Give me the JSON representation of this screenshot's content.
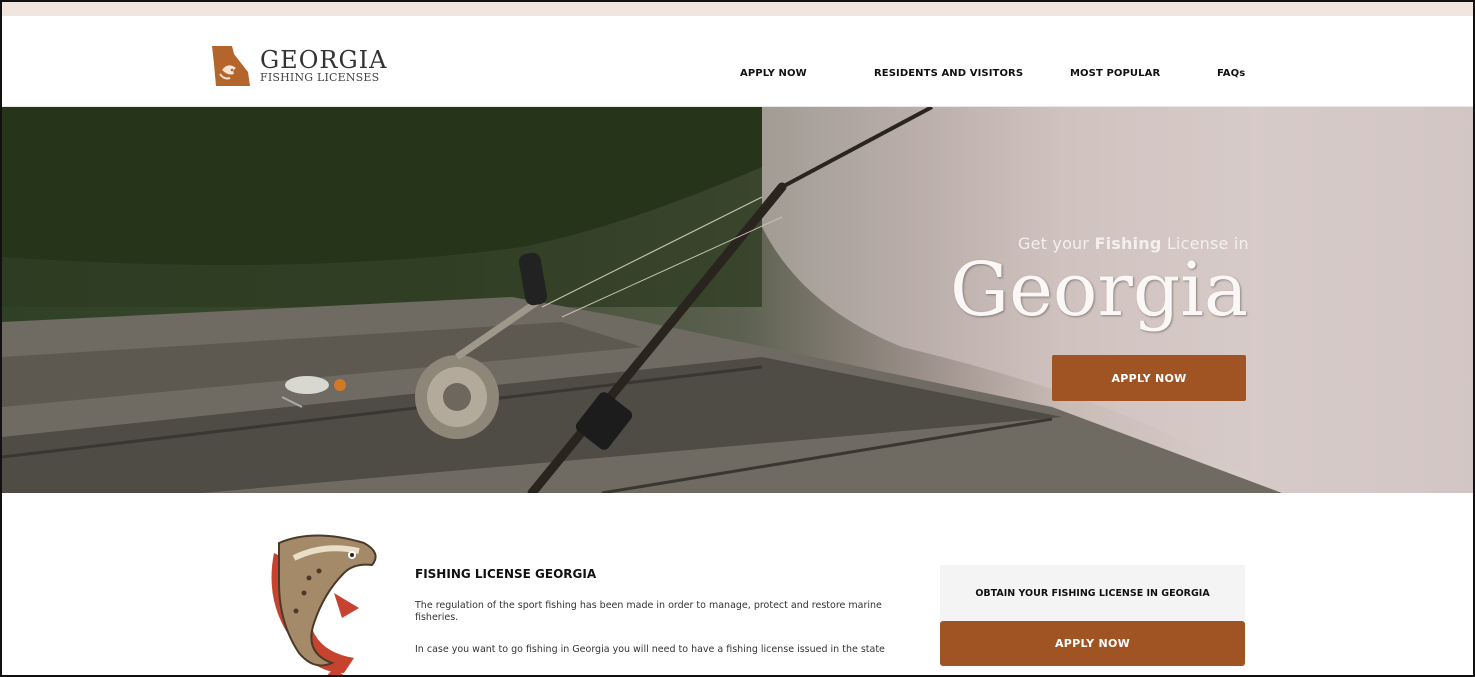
{
  "brand": {
    "title": "GEORGIA",
    "subtitle": "FISHING LICENSES",
    "accent_color": "#a05424",
    "logo_icon": "georgia-state-fish-icon"
  },
  "nav": {
    "items": [
      {
        "label": "APPLY NOW"
      },
      {
        "label": "RESIDENTS AND VISITORS"
      },
      {
        "label": "MOST POPULAR"
      },
      {
        "label": "FAQs"
      }
    ]
  },
  "hero": {
    "tagline_prefix": "Get your ",
    "tagline_bold": "Fishing",
    "tagline_suffix": " License in",
    "title": "Georgia",
    "button_label": "APPLY NOW"
  },
  "info": {
    "title": "FISHING LICENSE GEORGIA",
    "paragraph1": "The regulation of the sport fishing has been made in order to manage, protect and restore marine fisheries.",
    "paragraph2": "In case you want to go fishing in Georgia you will need to have a fishing license issued in the state",
    "illustration_icon": "jumping-fish-icon"
  },
  "cta": {
    "heading": "OBTAIN YOUR FISHING LICENSE IN GEORGIA",
    "button_label": "APPLY NOW"
  }
}
